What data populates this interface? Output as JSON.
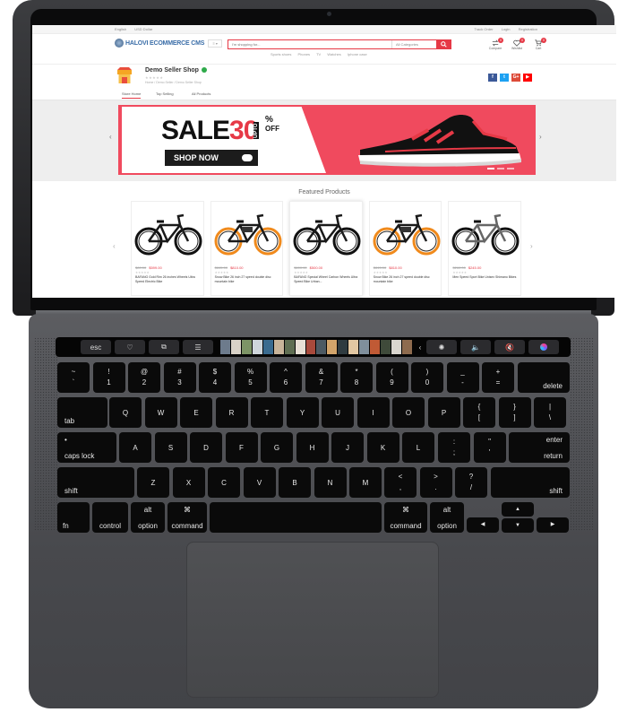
{
  "screen": {
    "util_bar": {
      "left": [
        "English",
        "USD Dollar"
      ],
      "right": [
        "Track Order",
        "Login",
        "Registration"
      ]
    },
    "logo": {
      "text": "HALOVI ECOMMERCE CMS",
      "dropdown": "Menu"
    },
    "search": {
      "placeholder": "I'm shopping for...",
      "category": "All Categories",
      "quick_links": [
        "Sports shoes",
        "Phones",
        "TV",
        "Watches",
        "Iphone case"
      ]
    },
    "header_icons": [
      {
        "name": "compare",
        "label": "Compare",
        "count": "0"
      },
      {
        "name": "wishlist",
        "label": "Wishlist",
        "count": "0"
      },
      {
        "name": "cart",
        "label": "Cart",
        "count": "0"
      }
    ],
    "shop": {
      "name": "Demo Seller Shop",
      "stars": "★★★★★",
      "breadcrumb": "Home  /  Demo Seller  /  Demo Seller Shop",
      "social": [
        {
          "name": "facebook",
          "glyph": "f",
          "color": "#3b5998"
        },
        {
          "name": "twitter",
          "glyph": "t",
          "color": "#1da1f2"
        },
        {
          "name": "google-plus",
          "glyph": "G+",
          "color": "#dd4b39"
        },
        {
          "name": "youtube",
          "glyph": "▶",
          "color": "#ff0000"
        }
      ]
    },
    "shop_tabs": [
      "Store Home",
      "Top Selling",
      "All Products"
    ],
    "banner": {
      "word1": "SALE",
      "word2": "30",
      "upto": "UPTO",
      "percent": "%",
      "off": "OFF",
      "cta": "SHOP NOW"
    },
    "featured": {
      "title": "Featured Products",
      "products": [
        {
          "old": "$80.00",
          "new": "$599.00",
          "stars": "★★★★★",
          "name": "BAFANG Gold Rim 26 inches Wheels Ultra Speed Electric Bike",
          "style": "mtb"
        },
        {
          "old": "$845.00",
          "new": "$810.00",
          "stars": "★★★★★",
          "name": "Snow Bike 26 inch 27 speed double disc mountain bike",
          "style": "ebike-orange"
        },
        {
          "old": "$600.00",
          "new": "$500.00",
          "stars": "★★★★★",
          "name": "BAFANG Special Wheel Carbon Wheels Ultra Speed Bike Urban...",
          "style": "mtb"
        },
        {
          "old": "$845.00",
          "new": "$810.00",
          "stars": "★★★★★",
          "name": "Snow Bike 26 inch 27 speed double disc mountain bike",
          "style": "ebike-orange"
        },
        {
          "old": "$260.00",
          "new": "$245.00",
          "stars": "★★★★★",
          "name": "Men Speed Sport Bike Unisex Shimano Bikes",
          "style": "city"
        }
      ]
    }
  },
  "touchbar": {
    "esc": "esc",
    "strip_colors": [
      "#6d7b8c",
      "#d9d2c7",
      "#7d9466",
      "#cfd6dc",
      "#3a6b8f",
      "#c9b59a",
      "#5f6e52",
      "#e8e0d5",
      "#a84a3c",
      "#4d5a63",
      "#d2a46b",
      "#2f3b40",
      "#e2c7a2",
      "#7f8f9c",
      "#c05a35",
      "#3f4a3a",
      "#dad6cf",
      "#8e6b4e"
    ],
    "controls": [
      "brightness-icon",
      "volume-icon",
      "mute-icon",
      "siri-icon"
    ]
  },
  "keyboard": {
    "row1": [
      [
        "~",
        "`"
      ],
      [
        "!",
        "1"
      ],
      [
        "@",
        "2"
      ],
      [
        "#",
        "3"
      ],
      [
        "$",
        "4"
      ],
      [
        "%",
        "5"
      ],
      [
        "^",
        "6"
      ],
      [
        "&",
        "7"
      ],
      [
        "*",
        "8"
      ],
      [
        "(",
        "9"
      ],
      [
        ")",
        "0"
      ],
      [
        "_",
        "-"
      ],
      [
        "+",
        "="
      ]
    ],
    "delete": "delete",
    "tab": "tab",
    "row2": [
      "Q",
      "W",
      "E",
      "R",
      "T",
      "Y",
      "U",
      "I",
      "O",
      "P"
    ],
    "row2_sym": [
      [
        "{",
        "["
      ],
      [
        "}",
        "]"
      ],
      [
        "|",
        "\\"
      ]
    ],
    "caps": "caps lock",
    "row3": [
      "A",
      "S",
      "D",
      "F",
      "G",
      "H",
      "J",
      "K",
      "L"
    ],
    "row3_sym": [
      [
        ":",
        ";"
      ],
      [
        "\"",
        "'"
      ]
    ],
    "enter_top": "enter",
    "enter_bottom": "return",
    "shift_l": "shift",
    "row4": [
      "Z",
      "X",
      "C",
      "V",
      "B",
      "N",
      "M"
    ],
    "row4_sym": [
      [
        "<",
        ","
      ],
      [
        ">",
        "."
      ],
      [
        "?",
        "/"
      ]
    ],
    "shift_r": "shift",
    "fn": "fn",
    "control": "control",
    "option_top": "alt",
    "option": "option",
    "command_sym": "⌘",
    "command": "command",
    "arrows": [
      "◀",
      "▲",
      "▼",
      "▶"
    ]
  }
}
